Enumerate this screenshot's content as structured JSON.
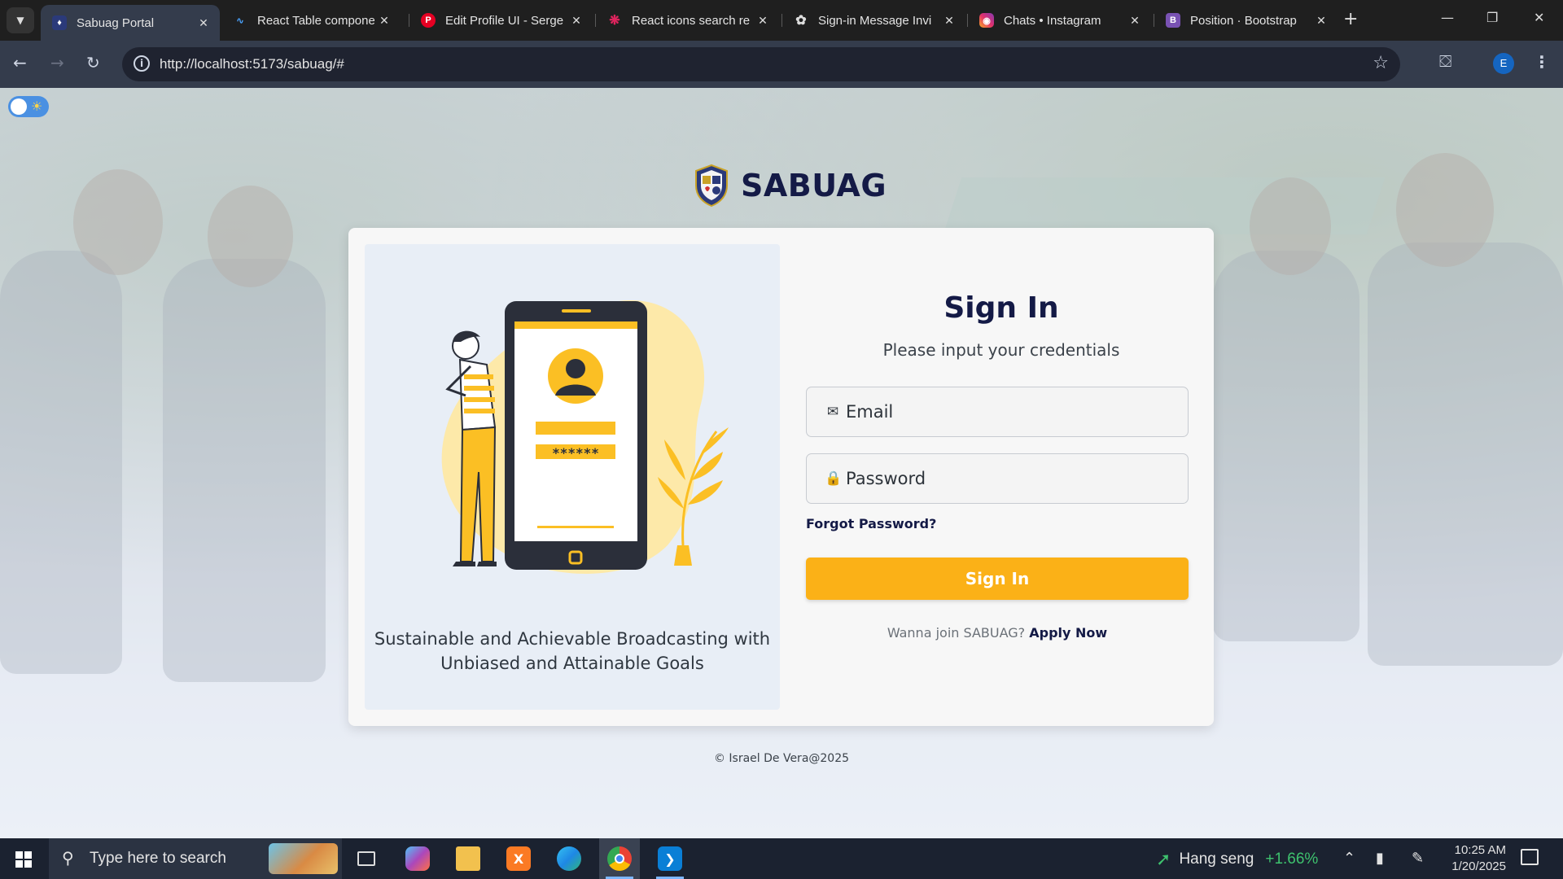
{
  "browser": {
    "tabs": [
      {
        "title": "Sabuag Portal",
        "icon": "sabuag-shield-icon",
        "active": true
      },
      {
        "title": "React Table compone",
        "icon": "react-table-icon",
        "active": false
      },
      {
        "title": "Edit Profile UI - Serge",
        "icon": "pinterest-icon",
        "active": false
      },
      {
        "title": "React icons search re",
        "icon": "react-icon",
        "active": false
      },
      {
        "title": "Sign-in Message Invi",
        "icon": "openai-icon",
        "active": false
      },
      {
        "title": "Chats • Instagram",
        "icon": "instagram-icon",
        "active": false
      },
      {
        "title": "Position · Bootstrap",
        "icon": "bootstrap-icon",
        "active": false
      }
    ],
    "url": "http://localhost:5173/sabuag/#",
    "profile_initial": "E"
  },
  "page": {
    "brand_name": "SABUAG",
    "tagline": "Sustainable and Achievable Broadcasting with Unbiased and Attainable Goals",
    "password_mask": "******",
    "signin": {
      "title": "Sign In",
      "subtitle": "Please input your credentials",
      "email_placeholder": "Email",
      "password_placeholder": "Password",
      "forgot_label": "Forgot Password?",
      "button_label": "Sign In",
      "join_prompt": "Wanna join SABUAG?",
      "apply_label": "Apply Now"
    },
    "footer": "© Israel De Vera@2025"
  },
  "taskbar": {
    "search_placeholder": "Type here to search",
    "ticker_name": "Hang seng",
    "ticker_value": "+1.66%",
    "time": "10:25 AM",
    "date": "1/20/2025"
  },
  "colors": {
    "accent": "#fbb117",
    "brand_navy": "#141a46",
    "ticker_positive": "#3ec26e"
  }
}
